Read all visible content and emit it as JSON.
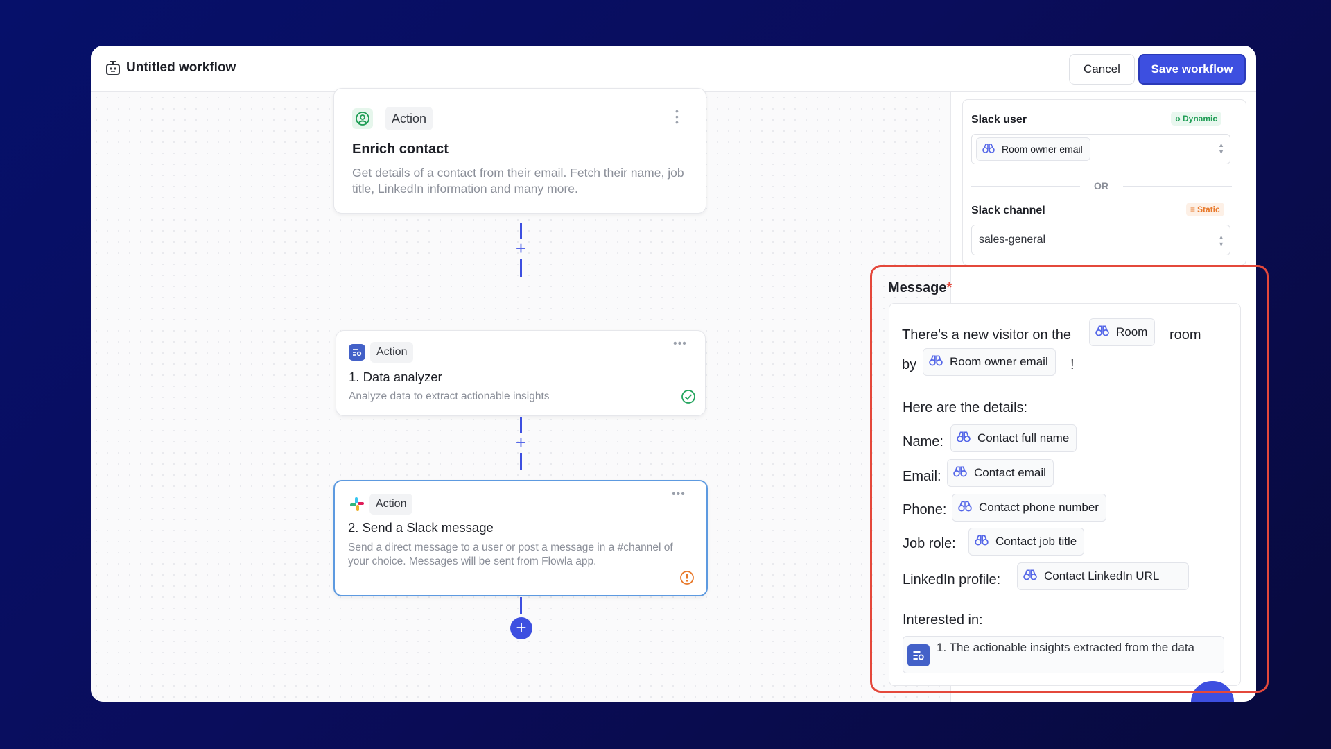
{
  "header": {
    "title": "Untitled workflow",
    "cancel_label": "Cancel",
    "save_label": "Save workflow"
  },
  "steps": [
    {
      "tag": "Action",
      "title": "Enrich contact",
      "description": "Get details of a contact from their email. Fetch their name, job title, LinkedIn information and many more.",
      "icon": "user-search-icon"
    },
    {
      "tag": "Action",
      "title": "1. Data analyzer",
      "description": "Analyze data to extract actionable insights",
      "icon": "data-analyzer-icon",
      "status": "complete"
    },
    {
      "tag": "Action",
      "title": "2. Send a Slack message",
      "description": "Send a direct message to a user or post a message in a #channel of your choice. Messages will be sent from Flowla app.",
      "icon": "slack-icon",
      "status": "warning"
    }
  ],
  "panel": {
    "slack_user": {
      "label": "Slack user",
      "badge": "Dynamic",
      "value": "Room owner email"
    },
    "or_text": "OR",
    "slack_channel": {
      "label": "Slack channel",
      "badge": "Static",
      "value": "sales-general"
    },
    "message": {
      "label": "Message",
      "required_mark": "*",
      "line1_prefix": "There's a new visitor on the",
      "line1_chip": "Room",
      "line1_suffix": "room",
      "line2_prefix": "by",
      "line2_chip": "Room owner email",
      "line2_suffix": "!",
      "details_heading": "Here are the details:",
      "fields": [
        {
          "label": "Name:",
          "chip": "Contact full name"
        },
        {
          "label": "Email:",
          "chip": "Contact email"
        },
        {
          "label": "Phone:",
          "chip": "Contact phone number"
        },
        {
          "label": "Job role:",
          "chip": "Contact job title"
        },
        {
          "label": "LinkedIn profile:",
          "chip": "Contact LinkedIn URL"
        }
      ],
      "interested_label": "Interested in:",
      "interested_chip": "1. The actionable insights extracted from the data"
    }
  },
  "colors": {
    "accent": "#3d4fe0",
    "highlight": "#e4483b",
    "dynamic": "#1f9d55",
    "static": "#e8792b",
    "success": "#22a45d",
    "warning": "#e8792b"
  }
}
